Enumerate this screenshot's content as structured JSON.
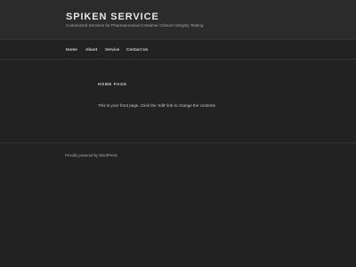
{
  "header": {
    "site_title": "SPIKEN SERVICE",
    "tagline": "Customized Services for Pharmaceutical Container Closure Integrity Testing"
  },
  "nav": {
    "items": [
      {
        "label": "Home"
      },
      {
        "label": "About"
      },
      {
        "label": "Service"
      },
      {
        "label": "Contact Us"
      }
    ]
  },
  "main": {
    "page_title": "HOME PAGE",
    "content": "This is your front page. Click the 'edit' link to change the contents"
  },
  "footer": {
    "powered_by": "Proudly powered by WordPress"
  },
  "colors": {
    "background": "#222222",
    "header_background": "#2b2b2b",
    "text": "#dddddd"
  }
}
